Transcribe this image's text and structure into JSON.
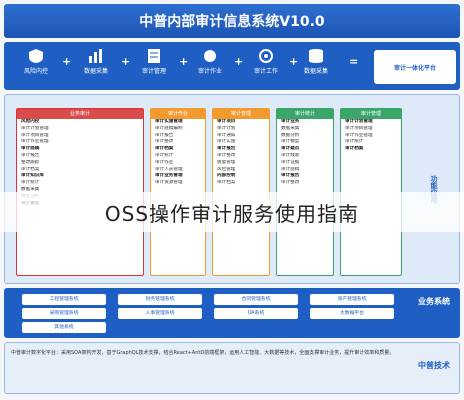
{
  "title": "中普内部审计信息系统V10.0",
  "top_modules": [
    {
      "label": "风险内控",
      "icon": "shield-icon"
    },
    {
      "label": "数据采集",
      "icon": "chart-icon"
    },
    {
      "label": "审计管理",
      "icon": "doc-icon"
    },
    {
      "label": "审计作业",
      "icon": "hand-icon"
    },
    {
      "label": "审计工作",
      "icon": "gear-icon"
    },
    {
      "label": "数据采集",
      "icon": "database-icon"
    }
  ],
  "top_right_label": "审计一体化平台",
  "side_label": "功能应用",
  "panels": [
    {
      "head": "业务审计",
      "color": "#d94c4c",
      "items": [
        "风险内控",
        "审计计划管理",
        "审计项目管理",
        "审计作业管理",
        "审计底稿",
        "审计报告",
        "整改跟踪",
        "审计档案",
        "审计知识库",
        "审计统计",
        "数据采集",
        "数据分析",
        "审计模型"
      ]
    },
    {
      "head": "审计作业",
      "color": "#f29a2e",
      "items": [
        "审计实施管理",
        "审计底稿编制",
        "审计报告",
        "审计整改",
        "审计档案",
        "审计统计",
        "审计作业",
        "审计人员管理",
        "审计业务管理",
        "审计资源管理"
      ]
    },
    {
      "head": "审计管理",
      "color": "#f29a2e",
      "items": [
        "审计项目",
        "审计计划",
        "审计通知",
        "审计实施",
        "审计报告",
        "审计整改",
        "质量管理",
        "风险管理",
        "内部控制",
        "审计档案"
      ]
    },
    {
      "head": "审计统计",
      "color": "#3aa66a",
      "items": [
        "审计业务",
        "数据采集",
        "数据分析",
        "审计模型",
        "审计疑点",
        "审计线索",
        "审计证据",
        "审计底稿",
        "审计报告",
        "审计整改"
      ]
    },
    {
      "head": "审计管理",
      "color": "#3aa66a",
      "items": [
        "审计计划管理",
        "审计项目管理",
        "审计作业管理",
        "审计统计",
        "审计档案"
      ]
    }
  ],
  "caption": "OSS操作审计服务使用指南",
  "sys_label": "业务系统",
  "sys_buttons": [
    "工程管理系统",
    "财务管理系统",
    "合同管理系统",
    "资产管理系统",
    "采购管理系统",
    "人事管理系统",
    "OA系统",
    "大数据平台",
    "其他系统"
  ],
  "footer_label": "中普技术",
  "footer_text": "中普审计数字化平台：采用SOA架构开发，基于GraphQL技术支撑，结合React+AntD前端框架，运用人工智能、大数据等技术，全面支撑审计业务，提升审计效率和质量。"
}
